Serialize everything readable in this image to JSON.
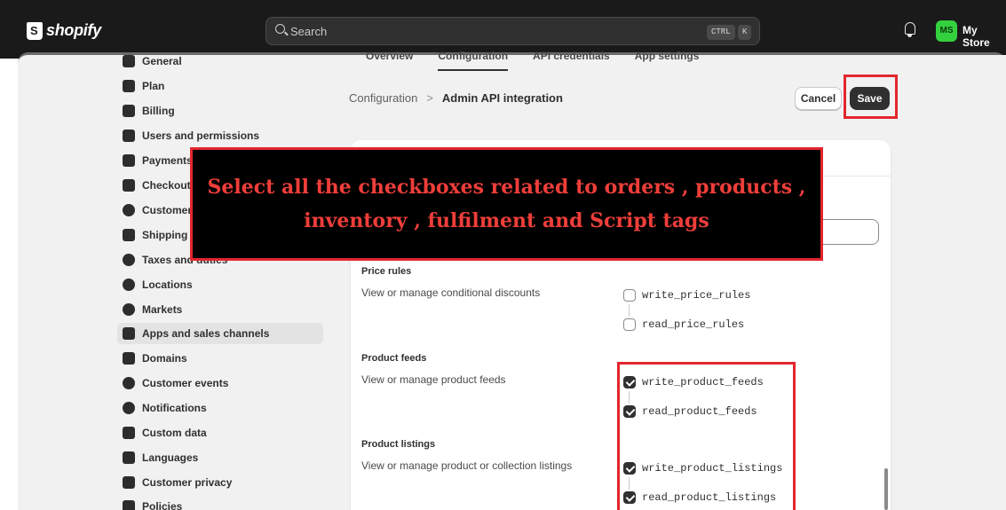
{
  "topbar": {
    "logo_text": "shopify",
    "search_placeholder": "Search",
    "shortcut_key1": "CTRL",
    "shortcut_key2": "K",
    "avatar_initials": "MS",
    "store_name": "My Store"
  },
  "close_label": "×",
  "sidebar": {
    "items": [
      {
        "label": "General",
        "icon": "store-icon"
      },
      {
        "label": "Plan",
        "icon": "plan-chart-icon"
      },
      {
        "label": "Billing",
        "icon": "billing-icon"
      },
      {
        "label": "Users and permissions",
        "icon": "users-icon"
      },
      {
        "label": "Payments",
        "icon": "payments-icon"
      },
      {
        "label": "Checkout",
        "icon": "cart-icon"
      },
      {
        "label": "Customer",
        "icon": "person-icon"
      },
      {
        "label": "Shipping a",
        "icon": "truck-icon"
      },
      {
        "label": "Taxes and duties",
        "icon": "taxes-icon"
      },
      {
        "label": "Locations",
        "icon": "location-pin-icon"
      },
      {
        "label": "Markets",
        "icon": "globe-icon"
      },
      {
        "label": "Apps and sales channels",
        "icon": "apps-icon"
      },
      {
        "label": "Domains",
        "icon": "domains-icon"
      },
      {
        "label": "Customer events",
        "icon": "cursor-click-icon"
      },
      {
        "label": "Notifications",
        "icon": "bell-icon"
      },
      {
        "label": "Custom data",
        "icon": "custom-data-icon"
      },
      {
        "label": "Languages",
        "icon": "languages-icon"
      },
      {
        "label": "Customer privacy",
        "icon": "lock-icon"
      },
      {
        "label": "Policies",
        "icon": "policies-icon"
      }
    ],
    "active_index": 11
  },
  "tabs": [
    {
      "label": "Overview"
    },
    {
      "label": "Configuration"
    },
    {
      "label": "API credentials"
    },
    {
      "label": "App settings"
    }
  ],
  "breadcrumb": {
    "parent": "Configuration",
    "separator": ">",
    "current": "Admin API integration"
  },
  "actions": {
    "cancel_label": "Cancel",
    "save_label": "Save"
  },
  "sections": [
    {
      "title": "Price rules",
      "description": "View or manage conditional discounts",
      "scopes": [
        {
          "name": "write_price_rules",
          "checked": false
        },
        {
          "name": "read_price_rules",
          "checked": false
        }
      ]
    },
    {
      "title": "Product feeds",
      "description": "View or manage product feeds",
      "scopes": [
        {
          "name": "write_product_feeds",
          "checked": true
        },
        {
          "name": "read_product_feeds",
          "checked": true
        }
      ]
    },
    {
      "title": "Product listings",
      "description": "View or manage product or collection listings",
      "scopes": [
        {
          "name": "write_product_listings",
          "checked": true
        },
        {
          "name": "read_product_listings",
          "checked": true
        }
      ]
    }
  ],
  "instruction": {
    "line1": "Select all the checkboxes related to orders , products ,",
    "line2": "inventory , fulfilment  and Script tags"
  },
  "colors": {
    "topbar_bg": "#1a1a1a",
    "avatar_bg": "#34d13f",
    "highlight_red": "#e3262d",
    "instruction_text": "#ef3e3a",
    "primary_button": "#303030"
  }
}
